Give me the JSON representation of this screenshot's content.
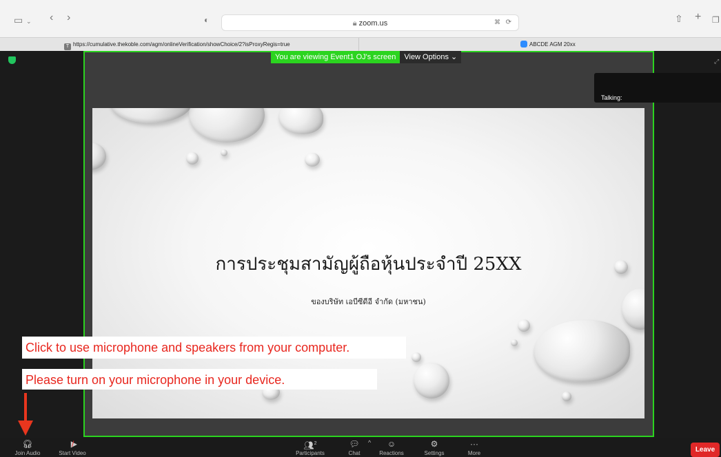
{
  "browser": {
    "address": "zoom.us",
    "tabs": [
      {
        "label": "https://cumulative.thekoble.com/agm/onlineVerification/showChoice/2?isProxyRegis=true",
        "favicon": "T"
      },
      {
        "label": "ABCDE AGM 20xx",
        "favicon": "zoom-icon"
      }
    ]
  },
  "meeting": {
    "banner": {
      "viewing": "You are viewing Event1 OJ's screen",
      "view_options": "View Options"
    },
    "talking_label": "Talking:",
    "accent_color": "#2bd41f"
  },
  "slide": {
    "title": "การประชุมสามัญผู้ถือหุ้นประจำปี 25XX",
    "subtitle": "ของบริษัท เอบีซีดีอี จำกัด (มหาชน)"
  },
  "annotations": {
    "note1": "Click to use microphone and speakers from your computer.",
    "note2": "Please turn on your microphone in your device.",
    "arrow_color": "#e8361e"
  },
  "controls": {
    "join_audio": "Join Audio",
    "start_video": "Start Video",
    "participants": "Participants",
    "participants_count": "2",
    "chat": "Chat",
    "reactions": "Reactions",
    "settings": "Settings",
    "more": "More",
    "leave": "Leave"
  }
}
